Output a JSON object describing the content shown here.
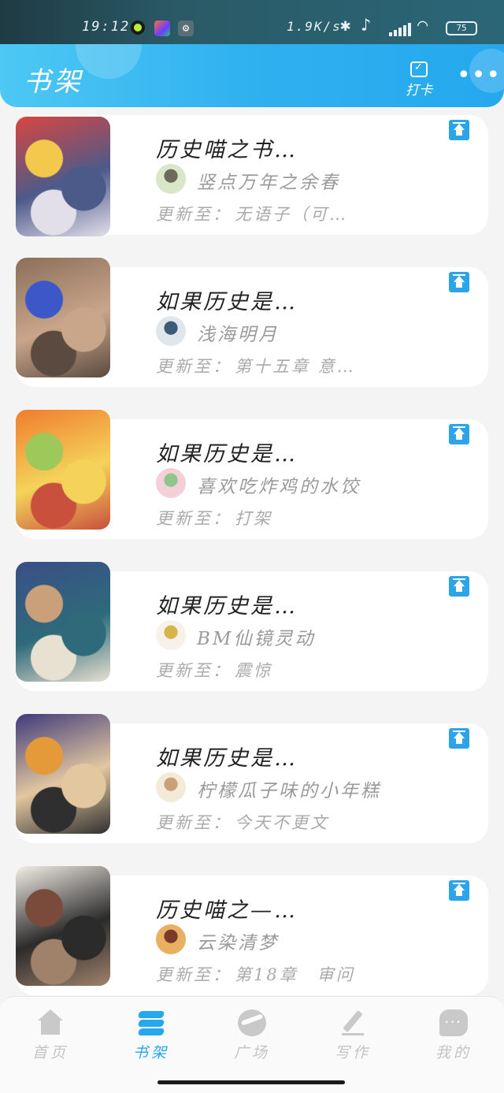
{
  "status_bar": {
    "time": "19:12",
    "net_speed": "1.9K/s",
    "battery": "75"
  },
  "header": {
    "title": "书架",
    "checkin_label": "打卡",
    "more_icon": "more-dots-icon"
  },
  "books": [
    {
      "title": "历史喵之书…",
      "author": "竖点万年之余春",
      "update_prefix": "更新至：",
      "update": "无语子（可…",
      "cover_colors": [
        "#d8463f",
        "#f2c94c",
        "#4c5a8a",
        "#e3dfe9"
      ],
      "avatar_colors": [
        "#d9e7c8",
        "#6c6a5a"
      ]
    },
    {
      "title": "如果历史是…",
      "author": "浅海明月",
      "update_prefix": "更新至：",
      "update": "第十五章 意…",
      "cover_colors": [
        "#8a6f5a",
        "#3c58c8",
        "#c9a58a",
        "#5a4a3f"
      ],
      "avatar_colors": [
        "#e0e6ea",
        "#3c5a7a"
      ]
    },
    {
      "title": "如果历史是…",
      "author": "喜欢吃炸鸡的水饺",
      "update_prefix": "更新至：",
      "update": "打架",
      "cover_colors": [
        "#f07c2e",
        "#9cc95a",
        "#f5d35a",
        "#c8503c"
      ],
      "avatar_colors": [
        "#f3d0d8",
        "#8fc58a"
      ]
    },
    {
      "title": "如果历史是…",
      "author": "BM仙镜灵动",
      "update_prefix": "更新至：",
      "update": "震惊",
      "cover_colors": [
        "#3a4f86",
        "#c9a07a",
        "#2e6a7a",
        "#e8e0d0"
      ],
      "avatar_colors": [
        "#f6f2ea",
        "#d7b34a"
      ]
    },
    {
      "title": "如果历史是…",
      "author": "柠檬瓜子味的小年糕",
      "update_prefix": "更新至：",
      "update": "今天不更文",
      "cover_colors": [
        "#3f3a7a",
        "#e59a3a",
        "#e2c7a0",
        "#2f2f2f"
      ],
      "avatar_colors": [
        "#f4ead8",
        "#c9a07a"
      ]
    },
    {
      "title": "历史喵之—…",
      "author": "云染清梦",
      "update_prefix": "更新至：",
      "update": "第18章　审问",
      "cover_colors": [
        "#f2ede6",
        "#7a4a3a",
        "#2b2b2b",
        "#a0826a"
      ],
      "avatar_colors": [
        "#e8b060",
        "#7a3a2a"
      ]
    }
  ],
  "bottom_nav": [
    {
      "label": "首页",
      "icon": "home-icon",
      "active": false
    },
    {
      "label": "书架",
      "icon": "bookshelf-icon",
      "active": true
    },
    {
      "label": "广场",
      "icon": "planet-icon",
      "active": false
    },
    {
      "label": "写作",
      "icon": "pen-icon",
      "active": false
    },
    {
      "label": "我的",
      "icon": "chat-bubble-icon",
      "active": false
    }
  ],
  "colors": {
    "accent": "#26a7ee",
    "header_start": "#4dc8f4",
    "inactive": "#c4c4c4"
  }
}
